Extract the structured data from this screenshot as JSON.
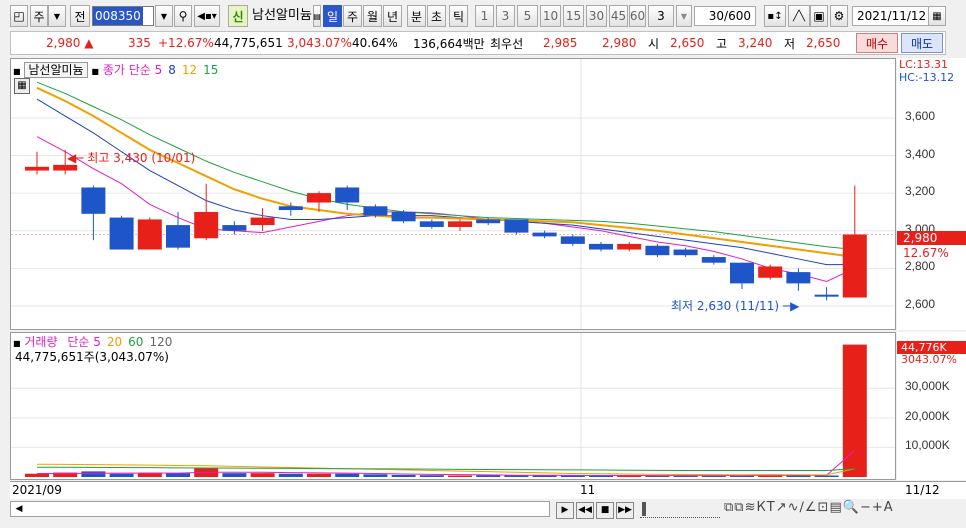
{
  "toolbar": {
    "market": "주",
    "mode": "전",
    "code": "008350",
    "stock_name": "남선알미늄",
    "new_badge": "신",
    "periods": [
      "일",
      "주",
      "월",
      "년",
      "분",
      "초",
      "틱"
    ],
    "selected_period": "일",
    "nums": [
      "1",
      "3",
      "5",
      "10",
      "15",
      "30",
      "45",
      "60"
    ],
    "count_value": "3",
    "range": "30/600",
    "date": "2021/11/12"
  },
  "quote": {
    "price": "2,980",
    "change": "335",
    "change_pct": "+12.67%",
    "volume": "44,775,651",
    "volume_pct": "3,043.07%",
    "turnover": "40.64%",
    "amount": "136,664백만",
    "best_label": "최우선",
    "ask": "2,985",
    "bid": "2,980",
    "open_label": "시",
    "open": "2,650",
    "high_label": "고",
    "high": "3,240",
    "low_label": "저",
    "low": "2,650",
    "buy": "매수",
    "sell": "매도"
  },
  "price_panel": {
    "name_tag": "남선알미늄",
    "legend": [
      {
        "text": "종가 단순 5",
        "color": "#e020c0"
      },
      {
        "text": "8",
        "color": "#2040c0"
      },
      {
        "text": "12",
        "color": "#f0a000"
      },
      {
        "text": "15",
        "color": "#20a040"
      }
    ],
    "high_annotation": "최고 3,430 (10/01)",
    "low_annotation": "최저 2,630 (11/11)",
    "lc": "LC:13.31",
    "hc": "HC:-13.12",
    "current_price_tag": "2,980",
    "current_pct_tag": "12.67%"
  },
  "volume_panel": {
    "legend_main": "거래량",
    "legend": [
      {
        "text": "단순 5",
        "color": "#e020c0"
      },
      {
        "text": "20",
        "color": "#f0a000"
      },
      {
        "text": "60",
        "color": "#20a040"
      },
      {
        "text": "120",
        "color": "#666666"
      }
    ],
    "summary": "44,775,651주(3,043.07%)",
    "current_tag": "44,776K",
    "current_pct": "3043.07%"
  },
  "x_axis": {
    "start": "2021/09",
    "mid": "11",
    "end": "11/12"
  },
  "chart_data": {
    "type": "candlestick",
    "price_axis": {
      "ticks": [
        2600,
        2800,
        3000,
        3200,
        3400,
        3600
      ],
      "labels": [
        "2,600",
        "2,800",
        "3,000",
        "3,200",
        "3,400",
        "3,600"
      ],
      "ylim": [
        2520,
        3860
      ]
    },
    "volume_axis": {
      "ticks": [
        10000,
        20000,
        30000
      ],
      "labels": [
        "10,000K",
        "20,000K",
        "30,000K"
      ],
      "ylim": [
        0,
        46000
      ]
    },
    "candles": [
      {
        "o": 3320,
        "c": 3340,
        "h": 3420,
        "l": 3300,
        "up": true
      },
      {
        "o": 3320,
        "c": 3350,
        "h": 3430,
        "l": 3300,
        "up": true
      },
      {
        "o": 3230,
        "c": 3090,
        "h": 3240,
        "l": 2950,
        "up": false
      },
      {
        "o": 3070,
        "c": 2900,
        "h": 3080,
        "l": 2900,
        "up": false
      },
      {
        "o": 2900,
        "c": 3060,
        "h": 3070,
        "l": 2900,
        "up": true
      },
      {
        "o": 3030,
        "c": 2910,
        "h": 3100,
        "l": 2900,
        "up": false
      },
      {
        "o": 2960,
        "c": 3100,
        "h": 3250,
        "l": 2950,
        "up": true
      },
      {
        "o": 3030,
        "c": 3000,
        "h": 3050,
        "l": 2980,
        "up": false
      },
      {
        "o": 3030,
        "c": 3070,
        "h": 3120,
        "l": 3000,
        "up": true
      },
      {
        "o": 3130,
        "c": 3110,
        "h": 3150,
        "l": 3080,
        "up": false
      },
      {
        "o": 3150,
        "c": 3200,
        "h": 3210,
        "l": 3100,
        "up": true
      },
      {
        "o": 3230,
        "c": 3150,
        "h": 3240,
        "l": 3110,
        "up": false
      },
      {
        "o": 3130,
        "c": 3080,
        "h": 3140,
        "l": 3070,
        "up": false
      },
      {
        "o": 3100,
        "c": 3050,
        "h": 3110,
        "l": 3040,
        "up": false
      },
      {
        "o": 3050,
        "c": 3020,
        "h": 3060,
        "l": 3010,
        "up": false
      },
      {
        "o": 3020,
        "c": 3050,
        "h": 3060,
        "l": 3000,
        "up": true
      },
      {
        "o": 3060,
        "c": 3040,
        "h": 3070,
        "l": 3030,
        "up": false
      },
      {
        "o": 3060,
        "c": 2990,
        "h": 3060,
        "l": 2980,
        "up": false
      },
      {
        "o": 2990,
        "c": 2970,
        "h": 3000,
        "l": 2960,
        "up": false
      },
      {
        "o": 2970,
        "c": 2930,
        "h": 2980,
        "l": 2920,
        "up": false
      },
      {
        "o": 2930,
        "c": 2900,
        "h": 2940,
        "l": 2890,
        "up": false
      },
      {
        "o": 2900,
        "c": 2930,
        "h": 2940,
        "l": 2890,
        "up": true
      },
      {
        "o": 2920,
        "c": 2870,
        "h": 2930,
        "l": 2860,
        "up": false
      },
      {
        "o": 2900,
        "c": 2870,
        "h": 2910,
        "l": 2860,
        "up": false
      },
      {
        "o": 2860,
        "c": 2830,
        "h": 2870,
        "l": 2820,
        "up": false
      },
      {
        "o": 2830,
        "c": 2720,
        "h": 2830,
        "l": 2690,
        "up": false
      },
      {
        "o": 2750,
        "c": 2810,
        "h": 2820,
        "l": 2740,
        "up": true
      },
      {
        "o": 2780,
        "c": 2720,
        "h": 2800,
        "l": 2680,
        "up": false
      },
      {
        "o": 2650,
        "c": 2660,
        "h": 2700,
        "l": 2630,
        "up": false
      },
      {
        "o": 2645,
        "c": 2980,
        "h": 3240,
        "l": 2645,
        "up": true
      }
    ],
    "volume": [
      1100,
      1500,
      1900,
      1100,
      1300,
      1300,
      3200,
      1300,
      1300,
      1100,
      1100,
      1100,
      900,
      700,
      600,
      500,
      600,
      500,
      500,
      500,
      400,
      400,
      500,
      500,
      400,
      500,
      900,
      600,
      500,
      44776
    ],
    "ma": {
      "ma5": [
        3500,
        3420,
        3330,
        3250,
        3140,
        3070,
        3010,
        3000,
        2990,
        3020,
        3050,
        3080,
        3100,
        3100,
        3095,
        3080,
        3060,
        3050,
        3040,
        3020,
        3000,
        2970,
        2940,
        2920,
        2890,
        2850,
        2800,
        2770,
        2730,
        2800
      ],
      "ma8": [
        3700,
        3610,
        3520,
        3420,
        3320,
        3240,
        3160,
        3110,
        3080,
        3060,
        3060,
        3070,
        3080,
        3080,
        3080,
        3070,
        3060,
        3050,
        3040,
        3030,
        3010,
        2990,
        2970,
        2950,
        2930,
        2910,
        2880,
        2850,
        2820,
        2820
      ],
      "ma12": [
        3760,
        3690,
        3610,
        3520,
        3430,
        3360,
        3290,
        3220,
        3170,
        3130,
        3110,
        3090,
        3080,
        3070,
        3070,
        3065,
        3060,
        3055,
        3050,
        3045,
        3030,
        3015,
        3000,
        2980,
        2960,
        2940,
        2920,
        2900,
        2880,
        2860
      ],
      "ma15": [
        3790,
        3730,
        3660,
        3590,
        3510,
        3440,
        3370,
        3310,
        3260,
        3210,
        3170,
        3140,
        3120,
        3100,
        3090,
        3080,
        3070,
        3065,
        3060,
        3055,
        3050,
        3040,
        3025,
        3010,
        2995,
        2975,
        2955,
        2935,
        2915,
        2900
      ]
    },
    "vol_ma": {
      "ma5": [
        1200,
        1200,
        1250,
        1300,
        1350,
        1300,
        1600,
        1600,
        1600,
        1500,
        1400,
        1300,
        1200,
        1000,
        900,
        800,
        700,
        600,
        600,
        550,
        500,
        500,
        480,
        480,
        460,
        470,
        560,
        600,
        600,
        9000
      ],
      "ma20": [
        4300,
        4250,
        4200,
        4100,
        4000,
        3900,
        3800,
        3600,
        3400,
        3200,
        3000,
        2800,
        2600,
        2400,
        2200,
        2000,
        1800,
        1600,
        1400,
        1200,
        1100,
        1000,
        900,
        850,
        800,
        780,
        760,
        740,
        720,
        2800
      ],
      "ma60": [
        3300,
        3300,
        3250,
        3200,
        3150,
        3100,
        3050,
        3000,
        2950,
        2900,
        2850,
        2800,
        2750,
        2700,
        2650,
        2600,
        2550,
        2500,
        2450,
        2400,
        2350,
        2300,
        2250,
        2200,
        2200,
        2200,
        2200,
        2200,
        2200,
        2800
      ]
    },
    "colors": {
      "up": "#e8201a",
      "down": "#1e55c8",
      "ma5": "#e020c0",
      "ma8": "#2040c0",
      "ma12": "#f0a000",
      "ma15": "#20a040",
      "vma120": "#666666"
    }
  }
}
